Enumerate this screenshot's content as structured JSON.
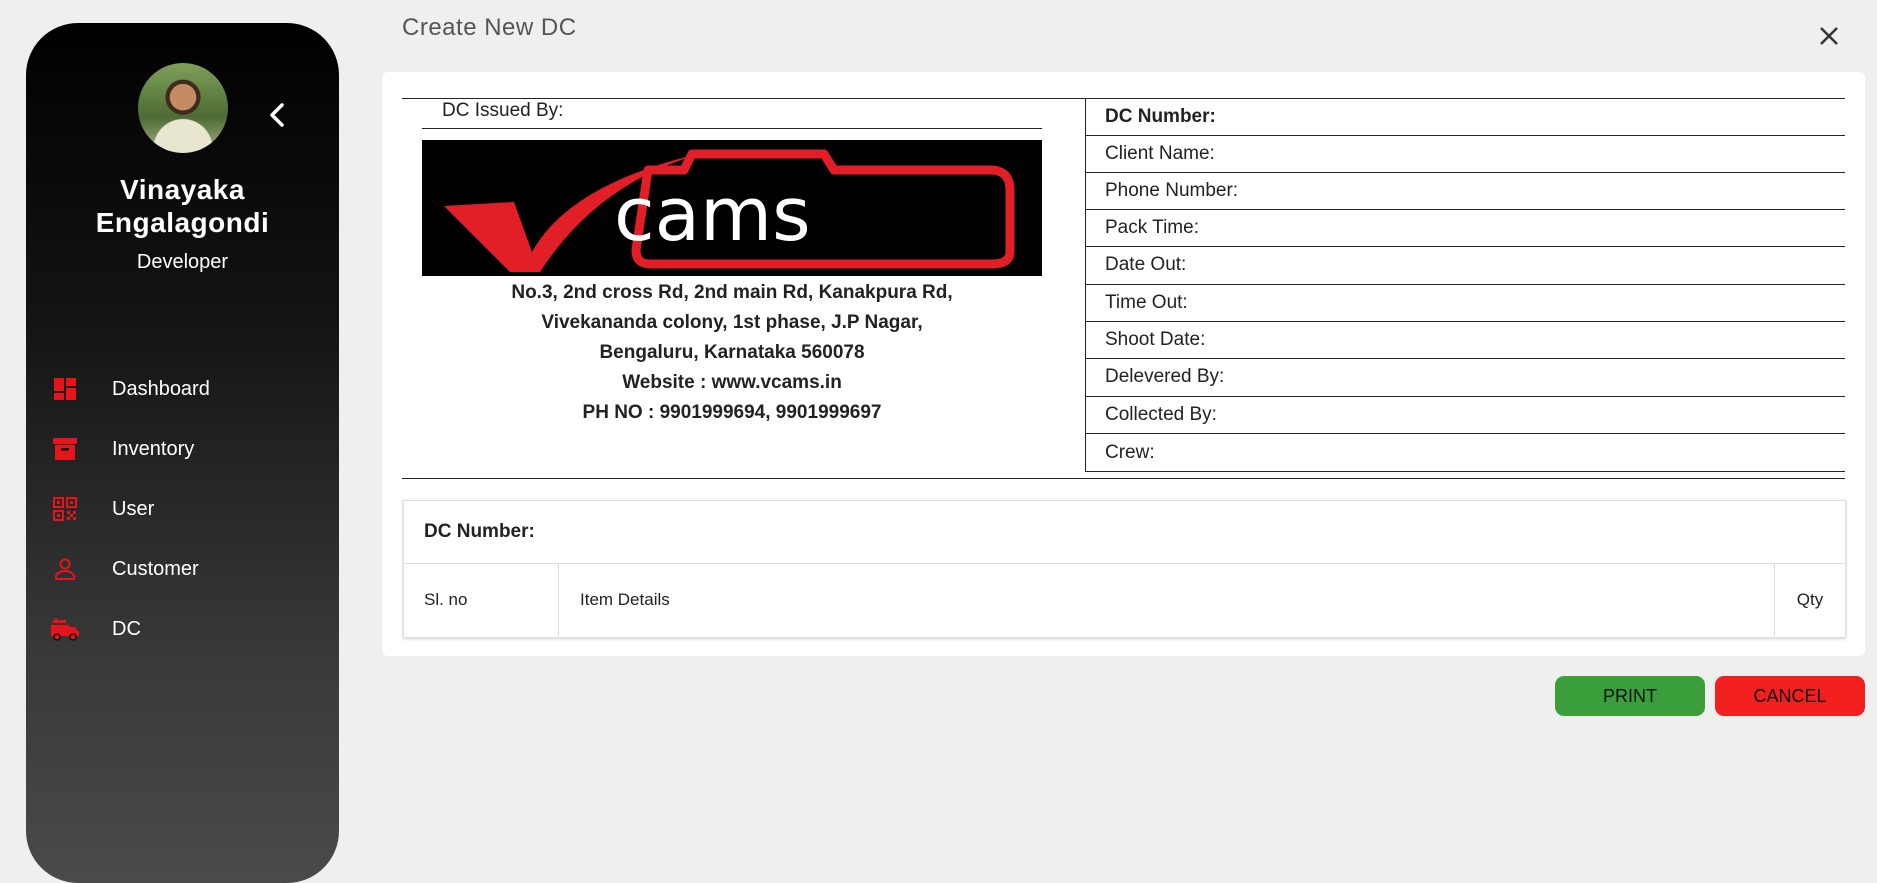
{
  "sidebar": {
    "user_name_line1": "Vinayaka",
    "user_name_line2": "Engalagondi",
    "user_role": "Developer",
    "items": [
      {
        "label": "Dashboard",
        "icon": "dashboard-icon"
      },
      {
        "label": "Inventory",
        "icon": "archive-icon"
      },
      {
        "label": "User",
        "icon": "qr-code-icon"
      },
      {
        "label": "Customer",
        "icon": "person-icon"
      },
      {
        "label": "DC",
        "icon": "fire-truck-icon"
      }
    ],
    "accent_color": "#e8141b"
  },
  "dialog": {
    "title": "Create New DC"
  },
  "form": {
    "issued_by_label": "DC Issued By:",
    "logo_text": "cams",
    "address_lines": [
      "No.3, 2nd cross Rd, 2nd main Rd, Kanakpura Rd,",
      "Vivekananda colony, 1st phase, J.P Nagar,",
      "Bengaluru, Karnataka 560078",
      "Website : www.vcams.in",
      "PH NO : 9901999694, 9901999697"
    ],
    "fields": [
      "DC Number:",
      "Client Name:",
      "Phone Number:",
      "Pack Time:",
      "Date Out:",
      "Time Out:",
      "Shoot Date:",
      "Delevered By:",
      "Collected By:",
      "Crew:"
    ]
  },
  "table": {
    "header": "DC Number:",
    "columns": [
      "Sl. no",
      "Item Details",
      "Qty"
    ]
  },
  "actions": {
    "print_label": "PRINT",
    "cancel_label": "CANCEL",
    "print_color": "#3a9e3a",
    "cancel_color": "#f21f1f"
  }
}
